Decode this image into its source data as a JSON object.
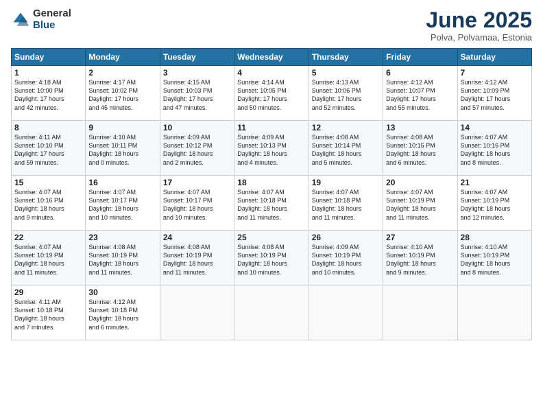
{
  "logo": {
    "general": "General",
    "blue": "Blue"
  },
  "title": "June 2025",
  "location": "Polva, Polvamaa, Estonia",
  "days_header": [
    "Sunday",
    "Monday",
    "Tuesday",
    "Wednesday",
    "Thursday",
    "Friday",
    "Saturday"
  ],
  "weeks": [
    [
      {
        "day": "1",
        "info": "Sunrise: 4:18 AM\nSunset: 10:00 PM\nDaylight: 17 hours\nand 42 minutes."
      },
      {
        "day": "2",
        "info": "Sunrise: 4:17 AM\nSunset: 10:02 PM\nDaylight: 17 hours\nand 45 minutes."
      },
      {
        "day": "3",
        "info": "Sunrise: 4:15 AM\nSunset: 10:03 PM\nDaylight: 17 hours\nand 47 minutes."
      },
      {
        "day": "4",
        "info": "Sunrise: 4:14 AM\nSunset: 10:05 PM\nDaylight: 17 hours\nand 50 minutes."
      },
      {
        "day": "5",
        "info": "Sunrise: 4:13 AM\nSunset: 10:06 PM\nDaylight: 17 hours\nand 52 minutes."
      },
      {
        "day": "6",
        "info": "Sunrise: 4:12 AM\nSunset: 10:07 PM\nDaylight: 17 hours\nand 55 minutes."
      },
      {
        "day": "7",
        "info": "Sunrise: 4:12 AM\nSunset: 10:09 PM\nDaylight: 17 hours\nand 57 minutes."
      }
    ],
    [
      {
        "day": "8",
        "info": "Sunrise: 4:11 AM\nSunset: 10:10 PM\nDaylight: 17 hours\nand 59 minutes."
      },
      {
        "day": "9",
        "info": "Sunrise: 4:10 AM\nSunset: 10:11 PM\nDaylight: 18 hours\nand 0 minutes."
      },
      {
        "day": "10",
        "info": "Sunrise: 4:09 AM\nSunset: 10:12 PM\nDaylight: 18 hours\nand 2 minutes."
      },
      {
        "day": "11",
        "info": "Sunrise: 4:09 AM\nSunset: 10:13 PM\nDaylight: 18 hours\nand 4 minutes."
      },
      {
        "day": "12",
        "info": "Sunrise: 4:08 AM\nSunset: 10:14 PM\nDaylight: 18 hours\nand 5 minutes."
      },
      {
        "day": "13",
        "info": "Sunrise: 4:08 AM\nSunset: 10:15 PM\nDaylight: 18 hours\nand 6 minutes."
      },
      {
        "day": "14",
        "info": "Sunrise: 4:07 AM\nSunset: 10:16 PM\nDaylight: 18 hours\nand 8 minutes."
      }
    ],
    [
      {
        "day": "15",
        "info": "Sunrise: 4:07 AM\nSunset: 10:16 PM\nDaylight: 18 hours\nand 9 minutes."
      },
      {
        "day": "16",
        "info": "Sunrise: 4:07 AM\nSunset: 10:17 PM\nDaylight: 18 hours\nand 10 minutes."
      },
      {
        "day": "17",
        "info": "Sunrise: 4:07 AM\nSunset: 10:17 PM\nDaylight: 18 hours\nand 10 minutes."
      },
      {
        "day": "18",
        "info": "Sunrise: 4:07 AM\nSunset: 10:18 PM\nDaylight: 18 hours\nand 11 minutes."
      },
      {
        "day": "19",
        "info": "Sunrise: 4:07 AM\nSunset: 10:18 PM\nDaylight: 18 hours\nand 11 minutes."
      },
      {
        "day": "20",
        "info": "Sunrise: 4:07 AM\nSunset: 10:19 PM\nDaylight: 18 hours\nand 11 minutes."
      },
      {
        "day": "21",
        "info": "Sunrise: 4:07 AM\nSunset: 10:19 PM\nDaylight: 18 hours\nand 12 minutes."
      }
    ],
    [
      {
        "day": "22",
        "info": "Sunrise: 4:07 AM\nSunset: 10:19 PM\nDaylight: 18 hours\nand 11 minutes."
      },
      {
        "day": "23",
        "info": "Sunrise: 4:08 AM\nSunset: 10:19 PM\nDaylight: 18 hours\nand 11 minutes."
      },
      {
        "day": "24",
        "info": "Sunrise: 4:08 AM\nSunset: 10:19 PM\nDaylight: 18 hours\nand 11 minutes."
      },
      {
        "day": "25",
        "info": "Sunrise: 4:08 AM\nSunset: 10:19 PM\nDaylight: 18 hours\nand 10 minutes."
      },
      {
        "day": "26",
        "info": "Sunrise: 4:09 AM\nSunset: 10:19 PM\nDaylight: 18 hours\nand 10 minutes."
      },
      {
        "day": "27",
        "info": "Sunrise: 4:10 AM\nSunset: 10:19 PM\nDaylight: 18 hours\nand 9 minutes."
      },
      {
        "day": "28",
        "info": "Sunrise: 4:10 AM\nSunset: 10:19 PM\nDaylight: 18 hours\nand 8 minutes."
      }
    ],
    [
      {
        "day": "29",
        "info": "Sunrise: 4:11 AM\nSunset: 10:18 PM\nDaylight: 18 hours\nand 7 minutes."
      },
      {
        "day": "30",
        "info": "Sunrise: 4:12 AM\nSunset: 10:18 PM\nDaylight: 18 hours\nand 6 minutes."
      },
      {
        "day": "",
        "info": ""
      },
      {
        "day": "",
        "info": ""
      },
      {
        "day": "",
        "info": ""
      },
      {
        "day": "",
        "info": ""
      },
      {
        "day": "",
        "info": ""
      }
    ]
  ]
}
